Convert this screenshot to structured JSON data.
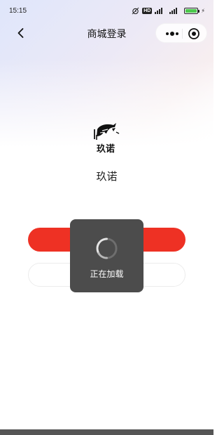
{
  "status_bar": {
    "time": "15:15",
    "hd_label": "HD"
  },
  "nav": {
    "title": "商城登录"
  },
  "logo": {
    "text": "玖诺"
  },
  "app": {
    "name": "玖诺"
  },
  "toast": {
    "text": "正在加载"
  },
  "colors": {
    "primary_button": "#ee3124",
    "toast_bg": "#4c4c4c",
    "battery": "#4cc94c"
  },
  "icons": [
    "back-icon",
    "more-icon",
    "close-mini-icon",
    "spinner-icon",
    "alarm-icon",
    "signal-icon",
    "battery-icon"
  ]
}
